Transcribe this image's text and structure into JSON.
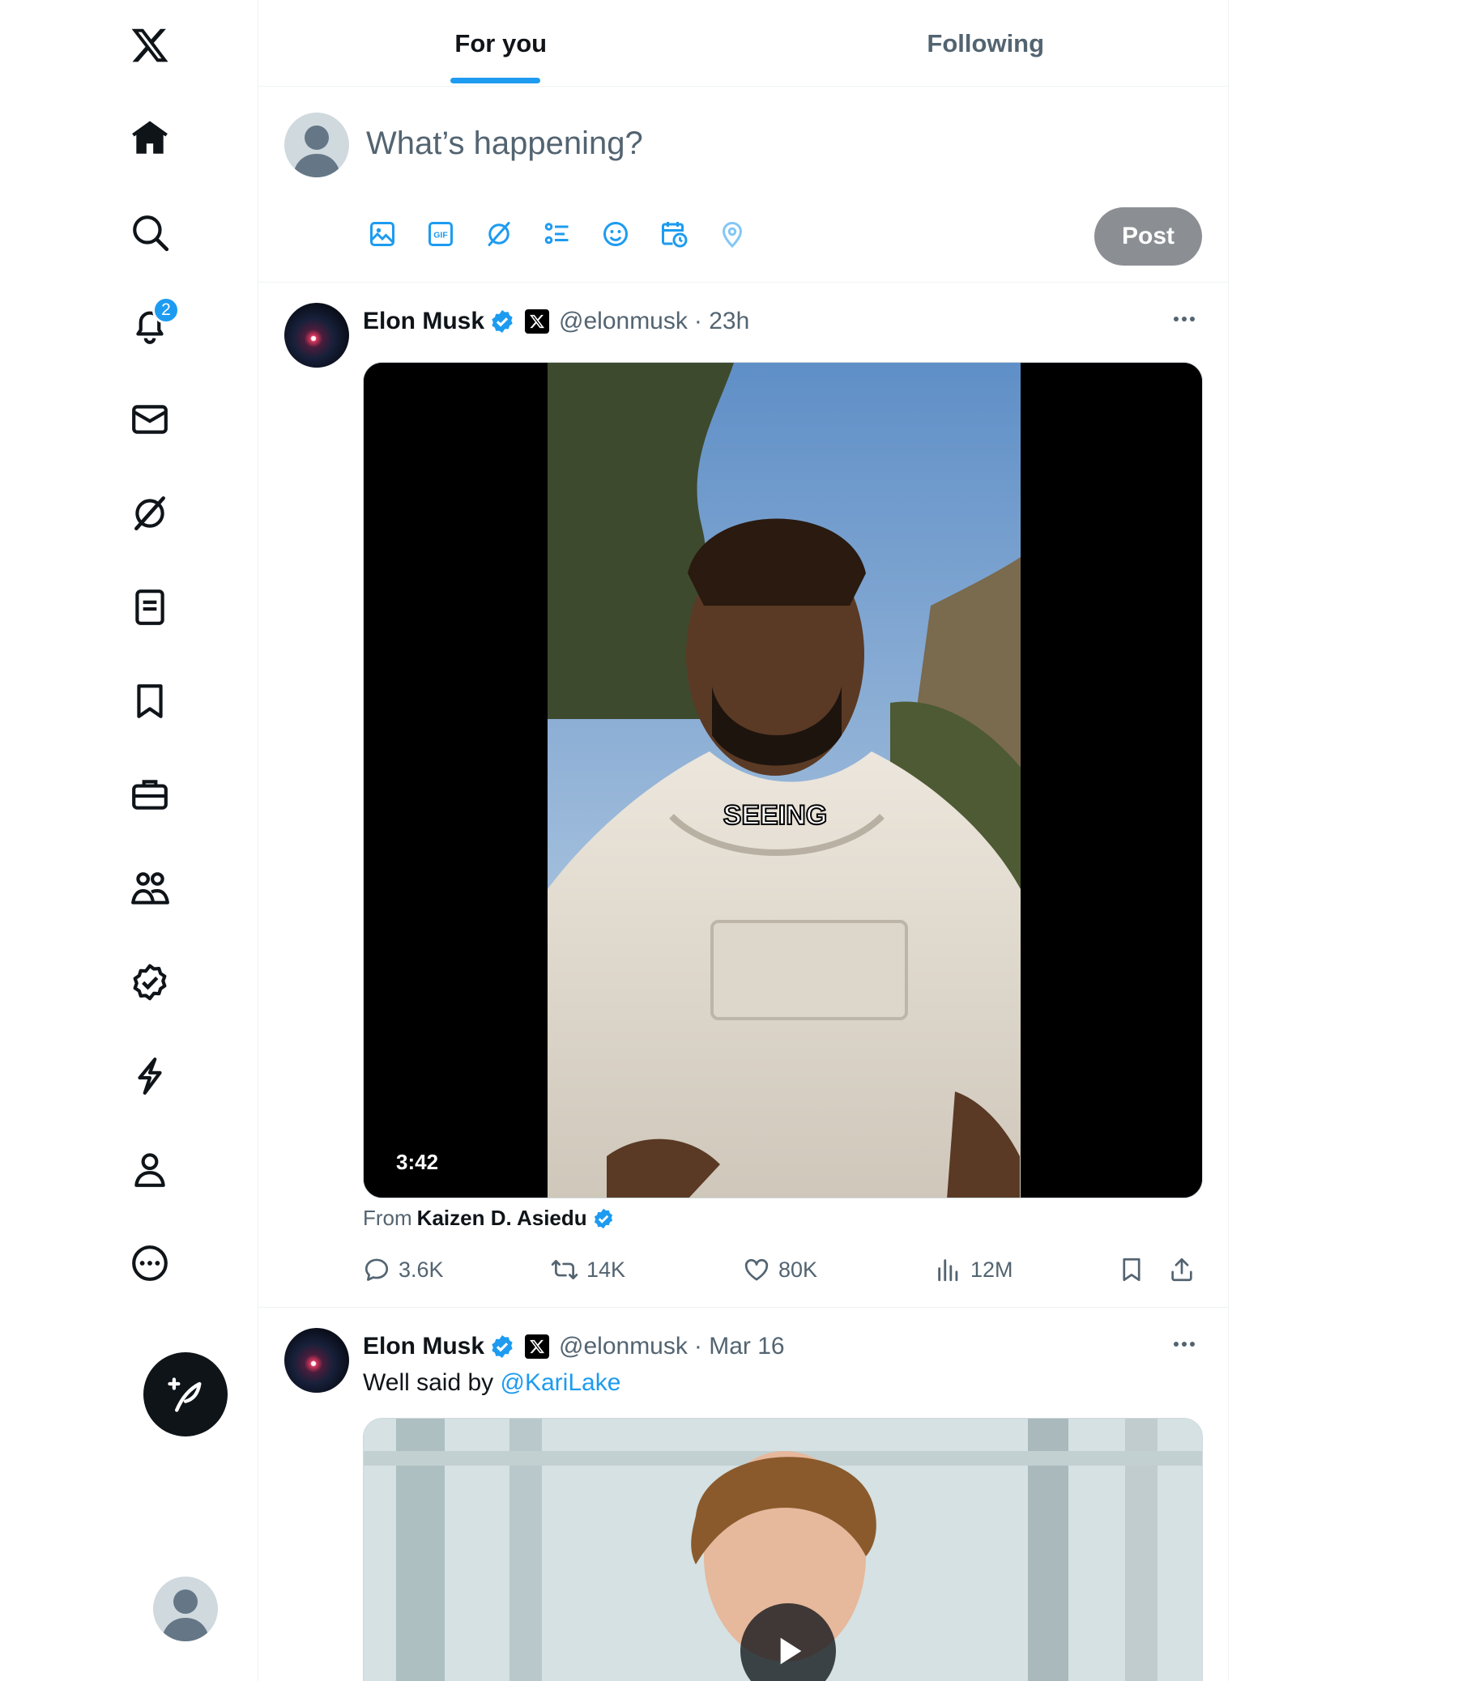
{
  "nav": {
    "notifications_badge": "2",
    "items": [
      {
        "name": "x-logo",
        "icon": "x-logo-icon"
      },
      {
        "name": "home",
        "icon": "home-icon"
      },
      {
        "name": "explore",
        "icon": "search-icon"
      },
      {
        "name": "notifications",
        "icon": "bell-icon"
      },
      {
        "name": "messages",
        "icon": "mail-icon"
      },
      {
        "name": "grok",
        "icon": "grok-icon"
      },
      {
        "name": "lists",
        "icon": "list-icon"
      },
      {
        "name": "bookmarks",
        "icon": "bookmark-icon"
      },
      {
        "name": "jobs",
        "icon": "briefcase-icon"
      },
      {
        "name": "communities",
        "icon": "people-icon"
      },
      {
        "name": "premium",
        "icon": "verified-icon"
      },
      {
        "name": "verified-orgs",
        "icon": "lightning-icon"
      },
      {
        "name": "profile",
        "icon": "person-icon"
      },
      {
        "name": "more",
        "icon": "more-circle-icon"
      }
    ]
  },
  "tabs": {
    "for_you": "For you",
    "following": "Following"
  },
  "composer": {
    "placeholder": "What’s happening?",
    "post_label": "Post"
  },
  "tweets": [
    {
      "name": "Elon Musk",
      "handle": "@elonmusk",
      "time": "· 23h",
      "video_duration": "3:42",
      "video_caption": "SEEING",
      "from_label": "From",
      "from_name": "Kaizen D. Asiedu",
      "replies": "3.6K",
      "reposts": "14K",
      "likes": "80K",
      "views": "12M"
    },
    {
      "name": "Elon Musk",
      "handle": "@elonmusk",
      "time": "· Mar 16",
      "text": "Well said by ",
      "mention": "@KariLake"
    }
  ],
  "colors": {
    "accent": "#1d9bf0",
    "text": "#0f1419",
    "secondary": "#536471",
    "post_disabled": "#8b8f94"
  }
}
